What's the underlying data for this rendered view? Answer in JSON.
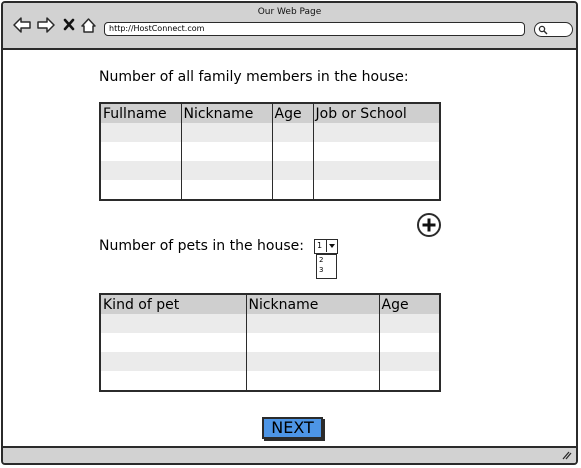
{
  "window": {
    "title": "Our Web Page"
  },
  "browser": {
    "url": "http://HostConnect.com"
  },
  "family": {
    "label": "Number of all family members in the house:",
    "columns": [
      "Fullname",
      "Nickname",
      "Age",
      "Job or School"
    ]
  },
  "pets": {
    "label": "Number of pets in the house:",
    "selected": "1",
    "options": [
      "2",
      "3"
    ],
    "columns": [
      "Kind of pet",
      "Nickname",
      "Age"
    ]
  },
  "next_label": "NEXT"
}
